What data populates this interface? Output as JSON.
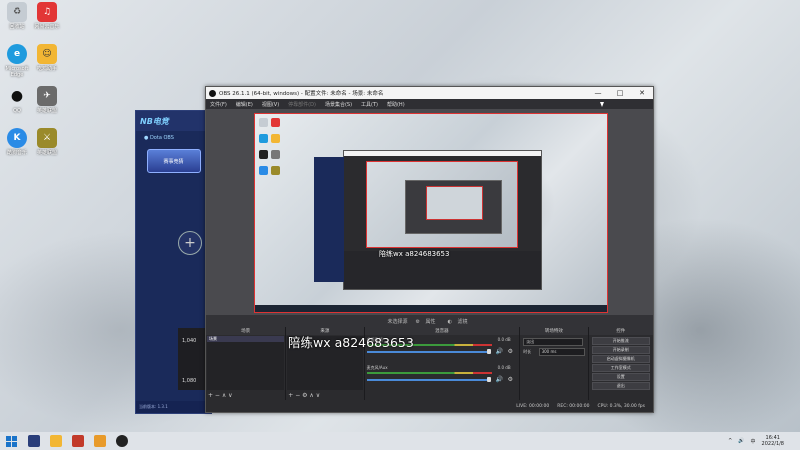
{
  "desktop": {
    "icons": [
      {
        "label": "回收站",
        "color": "#d0d6dc",
        "glyph": "♻"
      },
      {
        "label": "网易云音乐",
        "color": "#e23636",
        "glyph": "♫"
      },
      {
        "label": "Microsoft Edge",
        "color": "#1f9bde",
        "glyph": "e"
      },
      {
        "label": "吃鸡助手",
        "color": "#f2b634",
        "glyph": "☺"
      },
      {
        "label": "QQ",
        "color": "#1f1f1f",
        "glyph": "🐧"
      },
      {
        "label": "英雄联盟",
        "color": "#6b6b6b",
        "glyph": "✈"
      },
      {
        "label": "酷狗音乐",
        "color": "#2a8be6",
        "glyph": "K"
      },
      {
        "label": "英雄联盟",
        "color": "#9a8a2a",
        "glyph": "⚔"
      }
    ]
  },
  "left_app": {
    "logo": "NB电竞",
    "tab": "● Dota OBS",
    "banner": "赛事竞猜",
    "plus": "+",
    "side_values": [
      "1,040",
      "1,080"
    ],
    "footer": "当前版本: 1.3.1"
  },
  "obs": {
    "title": "OBS 26.1.1 (64-bit, windows) - 配置文件: 未命名 - 场景: 未命名",
    "window_controls": {
      "min": "—",
      "max": "□",
      "close": "✕"
    },
    "menu": [
      "文件(F)",
      "编辑(E)",
      "视图(V)",
      "停靠部件(D)",
      "场景集合(S)",
      "工具(T)",
      "帮助(H)"
    ],
    "source_toolbar": {
      "label": "未选择源",
      "properties": "属性",
      "filters": "滤镜"
    },
    "docks": {
      "scenes": {
        "title": "场景",
        "item": "场景",
        "controls": "+ − ∧ ∨"
      },
      "sources": {
        "title": "来源",
        "controls": "+ − ⚙ ∧ ∨"
      },
      "mixer": {
        "title": "混音器",
        "rows": [
          {
            "label": "桌面音频",
            "db": "0.0 dB"
          },
          {
            "label": "麦克风/Aux",
            "db": "0.0 dB"
          }
        ]
      },
      "transitions": {
        "title": "转场特效",
        "fade": "淡出",
        "duration_label": "时长",
        "duration": "300 ms"
      },
      "controls": {
        "title": "控件",
        "buttons": [
          "开始推流",
          "开始录制",
          "启动虚拟摄像机",
          "工作室模式",
          "设置",
          "退出"
        ]
      }
    },
    "status": {
      "live": "LIVE: 00:00:00",
      "rec": "REC: 00:00:00",
      "cpu": "CPU: 0.3%, 30.00 fps"
    }
  },
  "watermark": "陪练wx a824683653",
  "nested_watermark": "陪练wx a824683653",
  "taskbar": {
    "time": "16:41",
    "date": "2022/1/8",
    "tray": [
      "^",
      "🔊",
      "中"
    ]
  }
}
